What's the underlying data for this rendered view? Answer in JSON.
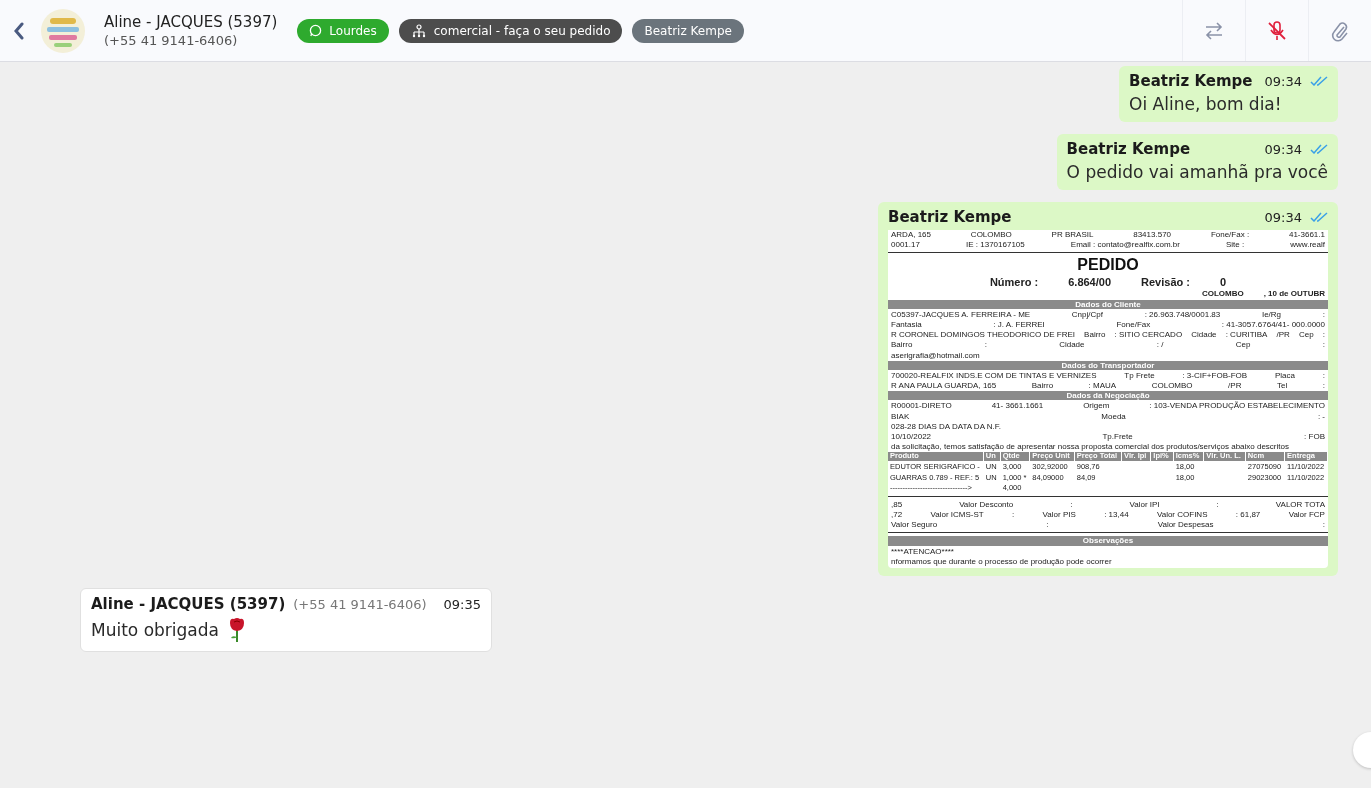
{
  "header": {
    "contact_name": "Aline - JACQUES (5397)",
    "contact_phone": "(+55 41 9141-6406)",
    "tags": [
      {
        "kind": "whatsapp",
        "label": "Lourdes",
        "color": "#2eaa2e"
      },
      {
        "kind": "department",
        "label": "comercial - faça o seu pedido",
        "color": "#4d4d4d"
      },
      {
        "kind": "agent",
        "label": "Beatriz Kempe",
        "color": "#6b747c"
      }
    ],
    "microphone_muted": true
  },
  "messages": [
    {
      "kind": "outgoing",
      "sender": "Beatriz Kempe",
      "time": "09:34",
      "read": true,
      "text": "Oi Aline, bom dia!"
    },
    {
      "kind": "outgoing",
      "sender": "Beatriz Kempe",
      "time": "09:34",
      "read": true,
      "text": "O pedido vai amanhã pra você"
    },
    {
      "kind": "outgoing",
      "sender": "Beatriz Kempe",
      "time": "09:34",
      "read": true,
      "document": [
        {
          "kind": "row",
          "cells": [
            "ARDA, 165",
            "COLOMBO",
            "PR  BRASIL",
            "83413.570",
            "Fone/Fax :",
            "41-3661.1"
          ]
        },
        {
          "kind": "row",
          "cells": [
            "0001.17",
            "IE :  1370167105",
            "Email :  contato@realfix.com.br",
            "Site :",
            "www.realf"
          ]
        },
        {
          "kind": "rule"
        },
        {
          "kind": "title",
          "text": "PEDIDO"
        },
        {
          "kind": "numbers",
          "cells": [
            "Número :",
            "6.864/00",
            "Revisão :",
            "0"
          ]
        },
        {
          "kind": "right",
          "cells": [
            "COLOMBO",
            ", 10 de OUTUBR"
          ]
        },
        {
          "kind": "section",
          "text": "Dados do Cliente"
        },
        {
          "kind": "row",
          "cells": [
            "C05397-JACQUES A. FERREIRA - ME",
            "Cnpj/Cpf",
            ": 26.963.748/0001.83",
            "Ie/Rg",
            ":"
          ]
        },
        {
          "kind": "row",
          "cells": [
            "Fantasia",
            ": J. A. FERREI",
            "Fone/Fax",
            ": 41-3057.6764/41- 000.0000"
          ]
        },
        {
          "kind": "row",
          "cells": [
            "R CORONEL DOMINGOS THEODORICO DE FREI",
            "Bairro",
            ": SITIO CERCADO",
            "Cidade",
            ": CURITIBA",
            "/PR",
            "Cep",
            ":"
          ]
        },
        {
          "kind": "row",
          "cells": [
            "Bairro",
            ":",
            "Cidade",
            ": /",
            "Cep",
            ":"
          ]
        },
        {
          "kind": "row",
          "cells": [
            "aserigrafia@hotmail.com"
          ]
        },
        {
          "kind": "section",
          "text": "Dados do Transportador"
        },
        {
          "kind": "row",
          "cells": [
            "700020-REALFIX INDS.E COM DE TINTAS E VERNIZES",
            "Tp Frete",
            ": 3-CIF+FOB-FOB",
            "Placa",
            ":"
          ]
        },
        {
          "kind": "row",
          "cells": [
            "R ANA PAULA GUARDA, 165",
            "Bairro",
            ": MAUA",
            "COLOMBO",
            "/PR",
            "Tel",
            ":"
          ]
        },
        {
          "kind": "section",
          "text": "Dados da Negociação"
        },
        {
          "kind": "row",
          "cells": [
            "R00001-DIRETO",
            "41- 3661.1661",
            "Origem",
            ": 103-VENDA PRODUÇÃO ESTABELECIMENTO"
          ]
        },
        {
          "kind": "row",
          "cells": [
            "BIAK",
            "Moeda",
            ": -"
          ]
        },
        {
          "kind": "row",
          "cells": [
            "028-28 DIAS DA DATA DA N.F."
          ]
        },
        {
          "kind": "row",
          "cells": [
            "10/10/2022",
            "Tp.Frete",
            ": FOB"
          ]
        },
        {
          "kind": "text",
          "text": "da solicitação, temos satisfação de apresentar nossa proposta comercial dos produtos/serviços abaixo descritos"
        },
        {
          "kind": "table",
          "columns": [
            "Produto",
            "Un",
            "Qtde",
            "Preço Unit",
            "Preço Total",
            "Vlr. Ipi",
            "Ipi%",
            "Icms%",
            "Vlr. Un. L.",
            "Ncm",
            "Entrega"
          ],
          "rows": [
            [
              "EDUTOR SERIGRAFICO -",
              "UN",
              "3,000",
              "302,92000",
              "908,76",
              "",
              "",
              "18,00",
              "",
              "27075090",
              "11/10/2022"
            ],
            [
              "GUARRAS 0.789 - REF.: 5",
              "UN",
              "1,000 *",
              "84,09000",
              "84,09",
              "",
              "",
              "18,00",
              "",
              "29023000",
              "11/10/2022"
            ],
            [
              "------------------------------->",
              "",
              "4,000",
              "",
              "",
              "",
              "",
              "",
              "",
              "",
              ""
            ]
          ]
        },
        {
          "kind": "rule"
        },
        {
          "kind": "row",
          "cells": [
            ",85",
            "Valor Desconto",
            ":",
            "Valor IPI",
            ":",
            "VALOR TOTA"
          ]
        },
        {
          "kind": "row",
          "cells": [
            ",72",
            "Valor ICMS-ST",
            ":",
            "Valor PIS",
            ": 13,44",
            "Valor COFINS",
            ": 61,87",
            "Valor FCP"
          ]
        },
        {
          "kind": "row",
          "cells": [
            "Valor Seguro",
            ":",
            "Valor Despesas",
            ":"
          ]
        },
        {
          "kind": "rule"
        },
        {
          "kind": "section",
          "text": "Observações"
        },
        {
          "kind": "text",
          "text": "****ATENCAO****"
        },
        {
          "kind": "text",
          "text": "nformamos que durante o processo de produção pode ocorrer"
        }
      ]
    },
    {
      "kind": "incoming",
      "sender": "Aline - JACQUES (5397)",
      "phone": "(+55 41 9141-6406)",
      "time": "09:35",
      "text": "Muito obrigada"
    }
  ]
}
